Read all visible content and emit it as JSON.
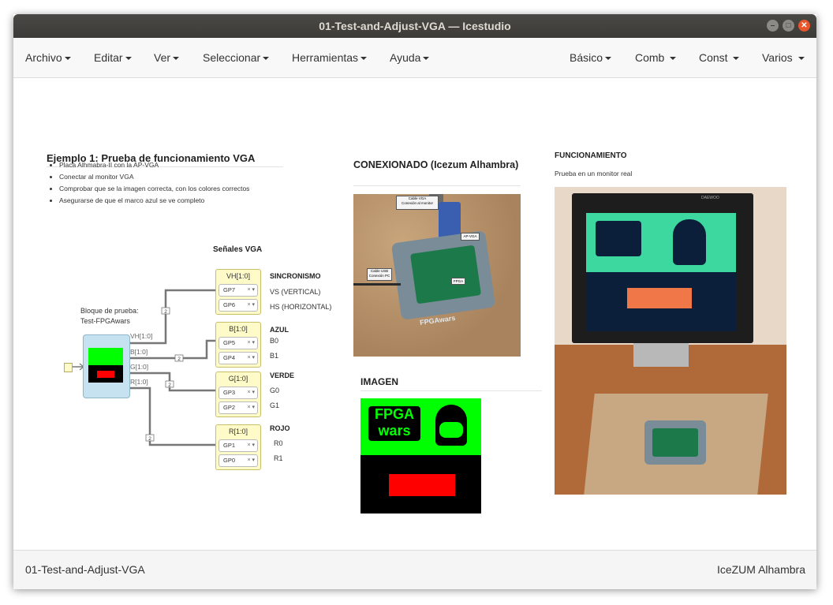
{
  "window": {
    "title": "01-Test-and-Adjust-VGA — Icestudio"
  },
  "menu": {
    "left": [
      "Archivo",
      "Editar",
      "Ver",
      "Seleccionar",
      "Herramientas",
      "Ayuda"
    ],
    "right": [
      "Básico",
      "Comb",
      "Const",
      "Varios"
    ]
  },
  "example": {
    "title": "Ejemplo 1: Prueba de funcionamiento VGA",
    "bullets": [
      "Placa Alhmabra-II con la AP-VGA",
      "Conectar al monitor VGA",
      "Comprobar que se la imagen correcta, con los colores correctos",
      "Asegurarse de que el marco azul se ve completo"
    ]
  },
  "signals": {
    "title": "Señales VGA",
    "block_label_1": "Bloque de prueba:",
    "block_label_2": "Test-FPGAwars",
    "ports": [
      "VH[1:0]",
      "B[1:0]",
      "G[1:0]",
      "R[1:0]"
    ],
    "bus_width": "2",
    "groups": [
      {
        "name": "VH[1:0]",
        "pins": [
          "GP7",
          "GP6"
        ],
        "heading": "SINCRONISMO",
        "labels": [
          "VS (VERTICAL)",
          "HS (HORIZONTAL)"
        ]
      },
      {
        "name": "B[1:0]",
        "pins": [
          "GP5",
          "GP4"
        ],
        "heading": "AZUL",
        "labels": [
          "B0",
          "B1"
        ]
      },
      {
        "name": "G[1:0]",
        "pins": [
          "GP3",
          "GP2"
        ],
        "heading": "VERDE",
        "labels": [
          "G0",
          "G1"
        ]
      },
      {
        "name": "R[1:0]",
        "pins": [
          "GP1",
          "GP0"
        ],
        "heading": "ROJO",
        "labels": [
          "R0",
          "R1"
        ]
      }
    ]
  },
  "conexionado": {
    "title": "CONEXIONADO (Icezum Alhambra)",
    "photo_labels": [
      "Cable VGA",
      "Conexión al monitor",
      "AP-VGA",
      "Cable USB",
      "Conexión PC",
      "FPGA",
      "FPGAwars"
    ]
  },
  "imagen": {
    "title": "IMAGEN",
    "logo_1": "FPGA",
    "logo_2": "wars"
  },
  "funcionamiento": {
    "title": "FUNCIONAMIENTO",
    "subtitle": "Prueba en un monitor real",
    "monitor_brand": "DAEWOO"
  },
  "footer": {
    "left": "01-Test-and-Adjust-VGA",
    "right": "IceZUM Alhambra"
  },
  "colors": {
    "titlebar": "#3c3b37",
    "io_box": "#fffbc8",
    "block": "#c6e2f0",
    "wire": "#777777",
    "image_green": "#00ff00",
    "image_red": "#ff0000",
    "close_button": "#e8562c"
  }
}
